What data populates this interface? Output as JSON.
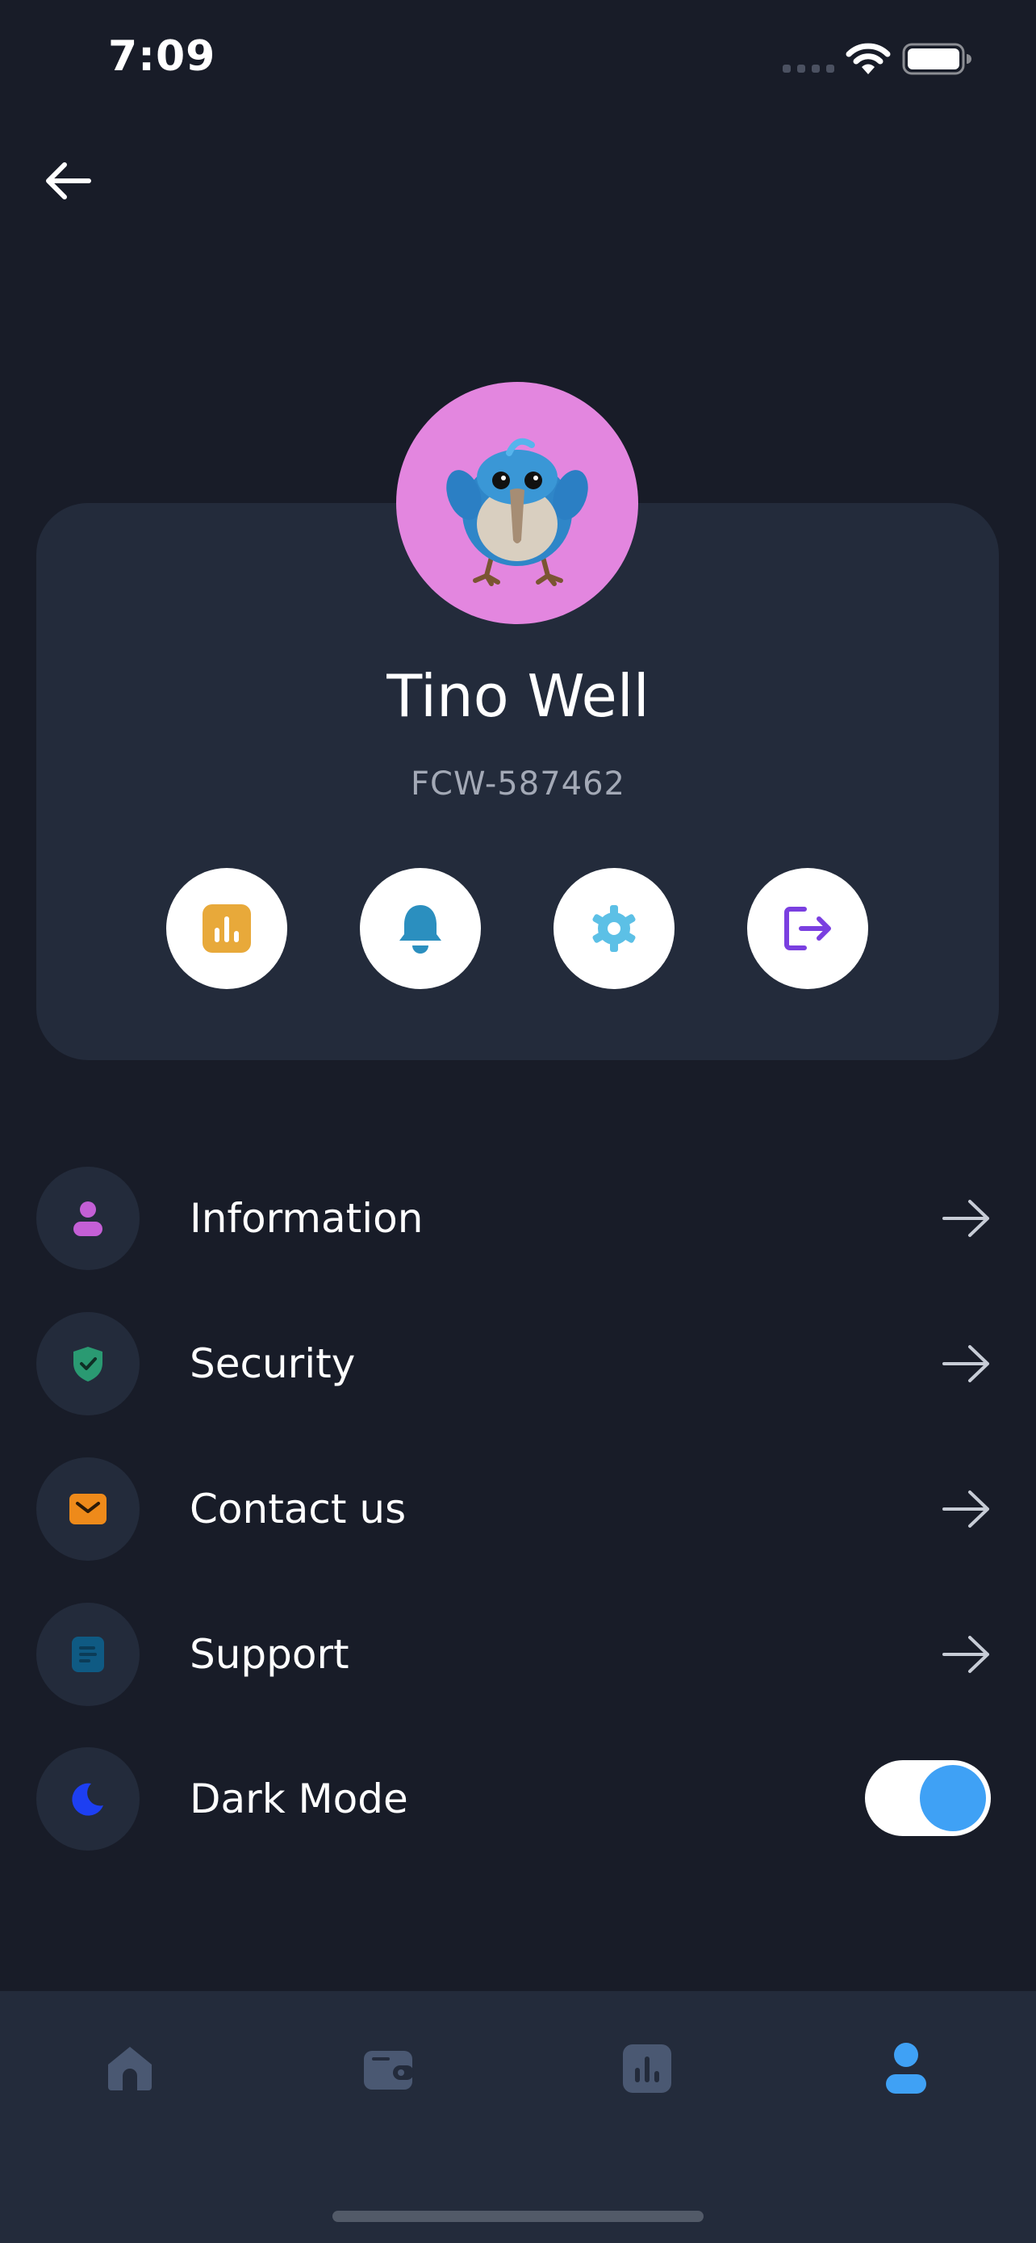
{
  "status_bar": {
    "time": "7:09"
  },
  "profile": {
    "name": "Tino Well",
    "user_id": "FCW-587462"
  },
  "quick_actions": [
    {
      "icon": "chart-icon",
      "color": "#e8a93a"
    },
    {
      "icon": "bell-icon",
      "color": "#2b8fbf"
    },
    {
      "icon": "gear-icon",
      "color": "#5cc0e6"
    },
    {
      "icon": "logout-icon",
      "color": "#7a3fe0"
    }
  ],
  "menu": {
    "items": [
      {
        "label": "Information",
        "icon": "user-icon",
        "color": "#c45fd6"
      },
      {
        "label": "Security",
        "icon": "shield-check-icon",
        "color": "#2a9a72"
      },
      {
        "label": "Contact us",
        "icon": "mail-icon",
        "color": "#ee8a1a"
      },
      {
        "label": "Support",
        "icon": "document-icon",
        "color": "#0f5a83"
      },
      {
        "label": "Dark Mode",
        "icon": "moon-icon",
        "color": "#1d3ff2"
      }
    ],
    "dark_mode_enabled": true
  },
  "tab_bar": {
    "tabs": [
      {
        "icon": "home-icon",
        "active": false
      },
      {
        "icon": "wallet-icon",
        "active": false
      },
      {
        "icon": "chart-icon",
        "active": false
      },
      {
        "icon": "profile-icon",
        "active": true
      }
    ],
    "active_color": "#3fa1f5",
    "inactive_color": "#4a5872"
  }
}
